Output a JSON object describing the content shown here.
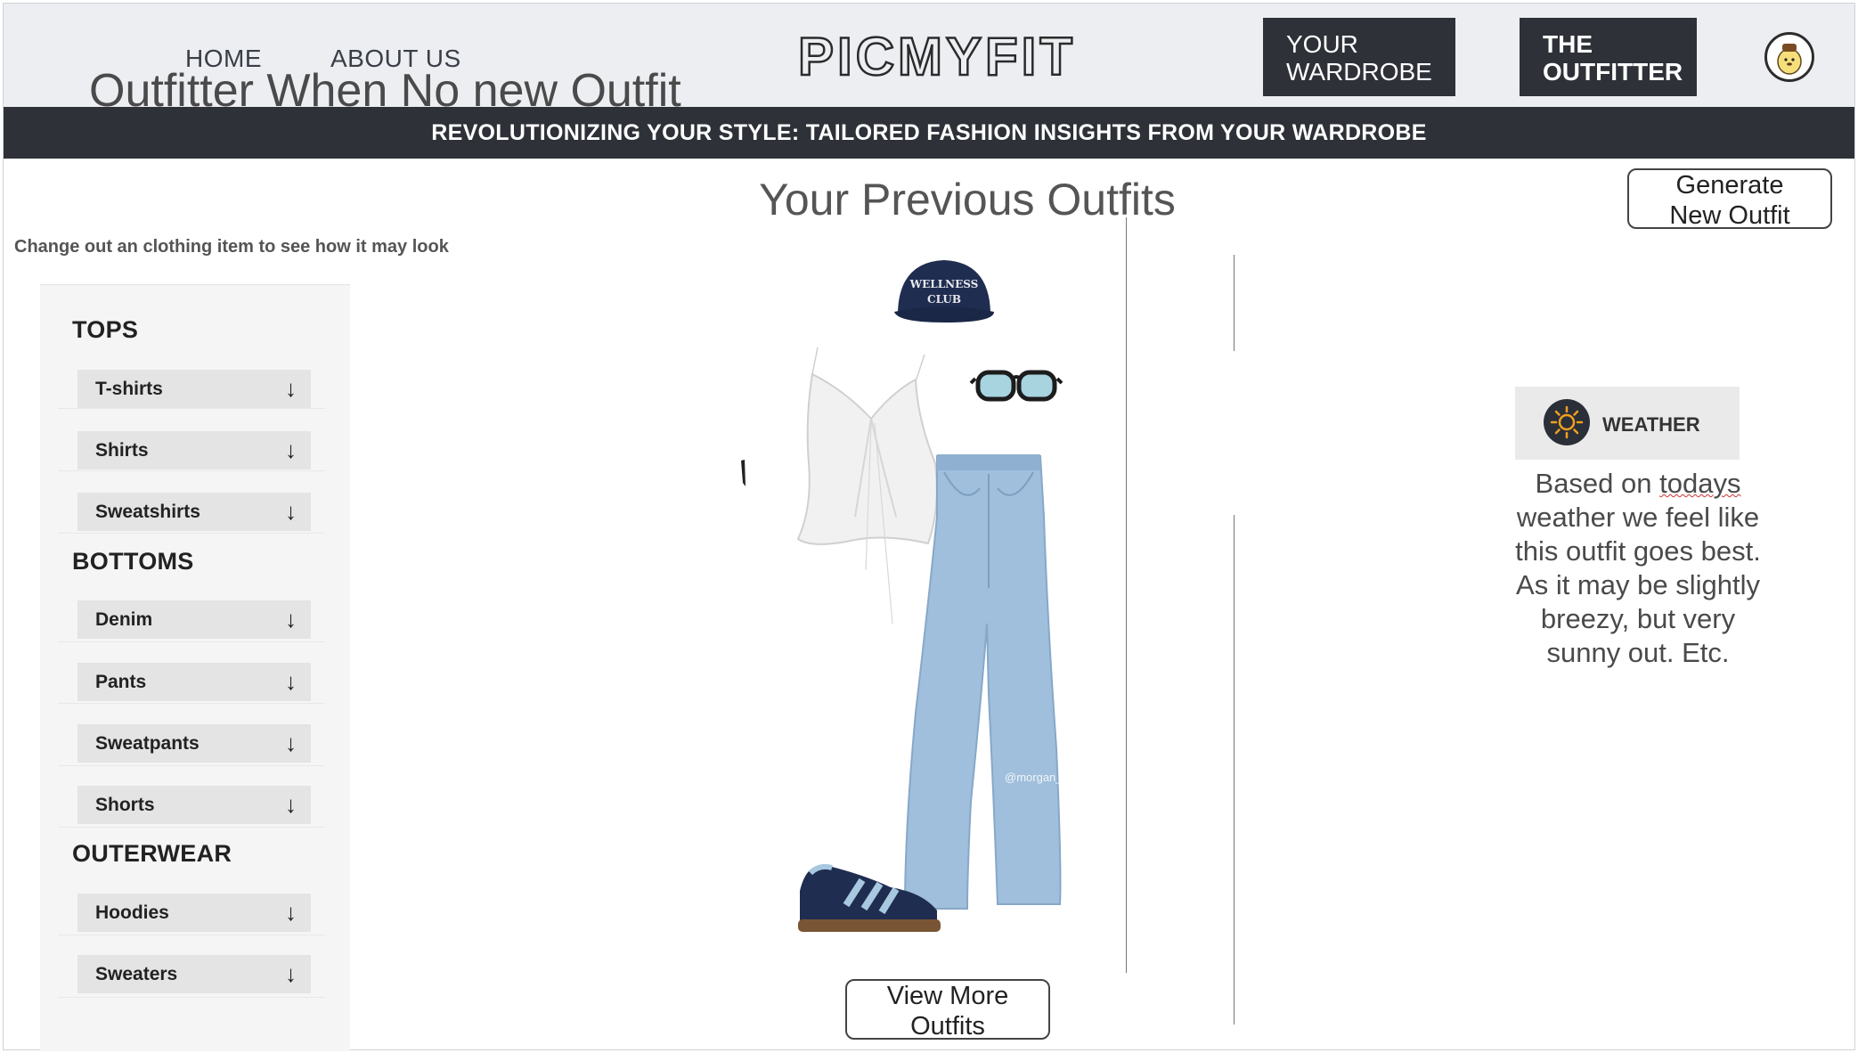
{
  "header": {
    "nav": [
      "HOME",
      "ABOUT US"
    ],
    "page_heading": "Outfitter When No new Outfit",
    "logo_text": "PICMYFIT",
    "wardrobe_btn": [
      "YOUR",
      "WARDROBE"
    ],
    "outfitter_btn": [
      "THE",
      "OUTFITTER"
    ],
    "avatar_icon": "pompompurin-avatar-icon"
  },
  "banner": "REVOLUTIONIZING YOUR STYLE: TAILORED FASHION INSIGHTS FROM YOUR WARDROBE",
  "main": {
    "title": "Your Previous Outfits",
    "generate_btn": [
      "Generate",
      "New Outfit"
    ],
    "hint": "Change out an clothing item to see how it may look",
    "view_more_btn": [
      "View More",
      "Outfits"
    ],
    "watermark": "@morgan_active"
  },
  "sidebar": {
    "arrow": "↓",
    "categories": [
      {
        "name": "TOPS",
        "items": [
          "T-shirts",
          "Shirts",
          "Sweatshirts"
        ]
      },
      {
        "name": "BOTTOMS",
        "items": [
          "Denim",
          "Pants",
          "Sweatpants",
          "Shorts"
        ]
      },
      {
        "name": "OUTERWEAR",
        "items": [
          "Hoodies",
          "Sweaters"
        ]
      }
    ]
  },
  "weather": {
    "label": "WEATHER",
    "text_lines": [
      "Based on ",
      "todays",
      "weather we feel like",
      "this outfit goes best.",
      "As it may be slightly",
      "breezy, but very",
      "sunny out. Etc."
    ]
  },
  "outfit_items": {
    "cap_text": [
      "WELLNESS",
      "CLUB"
    ]
  },
  "colors": {
    "dark": "#2e3138",
    "header_bg": "#eceef2",
    "denim": "#9fbfdc",
    "navy": "#1f2d50",
    "sun": "#f0a020"
  }
}
